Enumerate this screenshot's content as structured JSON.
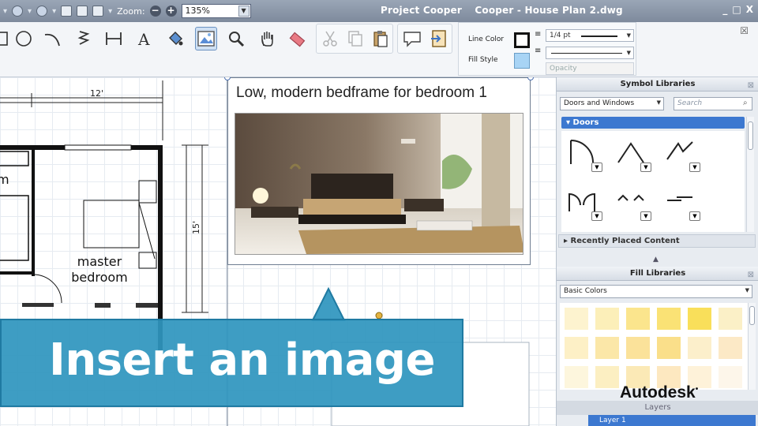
{
  "titlebar": {
    "zoom_label": "Zoom:",
    "zoom_minus": "−",
    "zoom_plus": "+",
    "zoom_value": "135%",
    "app_name": "Project Cooper",
    "document_title": "Cooper - House Plan 2.dwg",
    "window_controls": [
      "_",
      "□",
      "X"
    ]
  },
  "toolbar": {
    "line_color_label": "Line Color",
    "fill_style_label": "Fill Style",
    "line_weight_value": "1/4 pt",
    "opacity_placeholder": "Opacity",
    "close_glyph": "☒"
  },
  "canvas": {
    "dim_top": "12'",
    "dim_side": "15'",
    "room_left_fragment": "m",
    "room_master_line1": "master",
    "room_master_line2": "bedroom"
  },
  "image_callout": {
    "caption": "Low, modern bedframe for bedroom 1"
  },
  "panel": {
    "symbol_libraries_title": "Symbol Libraries",
    "category_select": "Doors and Windows",
    "search_placeholder": "Search",
    "doors_header": "Doors",
    "recently_placed": "Recently Placed Content",
    "fill_libraries_title": "Fill Libraries",
    "fill_select": "Basic Colors",
    "layers_title": "Layers",
    "layer_row": "Layer 1",
    "fill_colors": [
      [
        "#fdf3cf",
        "#fcefb9",
        "#fbe58d",
        "#fae275",
        "#f9df5a",
        "#fbf0c7"
      ],
      [
        "#fdf0c6",
        "#fbe7a8",
        "#fbe29a",
        "#fadf8a",
        "#fcefcb",
        "#fce9c6"
      ],
      [
        "#fdf6dd",
        "#fcefc2",
        "#fbe9b6",
        "#fde8c0",
        "#fef2d9",
        "#fdf6ea"
      ]
    ]
  },
  "overlay": {
    "headline": "Insert an image",
    "brand": "Autodesk",
    "brand_mark": "•"
  },
  "colors": {
    "banner": "#2f96be",
    "doors_header": "#3c78d0",
    "fill_swatch": "#a8d4f5"
  }
}
